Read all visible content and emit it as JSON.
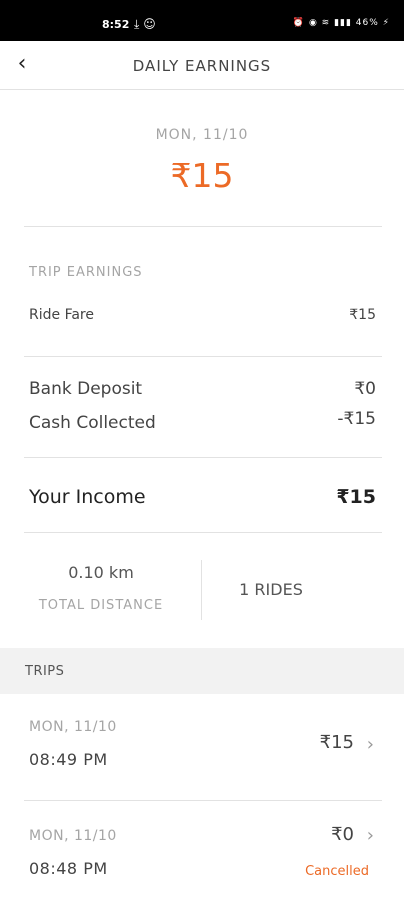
{
  "status_bar": {
    "time": "8:52",
    "battery": "46%"
  },
  "header": {
    "title": "DAILY EARNINGS"
  },
  "summary": {
    "day": "MON, 11/10",
    "total": "₹15"
  },
  "trip_earnings": {
    "heading": "TRIP EARNINGS",
    "ride_fare_label": "Ride Fare",
    "ride_fare_value": "₹15"
  },
  "payments": {
    "bank_deposit_label": "Bank Deposit",
    "bank_deposit_value": "₹0",
    "cash_collected_label": "Cash Collected",
    "cash_collected_value": "-₹15"
  },
  "income": {
    "label": "Your Income",
    "value": "₹15"
  },
  "stats": {
    "distance": "0.10 km",
    "distance_label": "TOTAL DISTANCE",
    "rides": "1 RIDES"
  },
  "trips": {
    "heading": "TRIPS",
    "items": [
      {
        "date": "MON, 11/10",
        "time": "08:49 PM",
        "fare": "₹15",
        "status": ""
      },
      {
        "date": "MON, 11/10",
        "time": "08:48 PM",
        "fare": "₹0",
        "status": "Cancelled"
      }
    ]
  },
  "icons": {
    "back": "arrow-back-icon",
    "chevron": "chevron-right-icon"
  },
  "colors": {
    "accent": "#ec6a26",
    "muted": "#a5a5a5",
    "text": "#444444"
  }
}
